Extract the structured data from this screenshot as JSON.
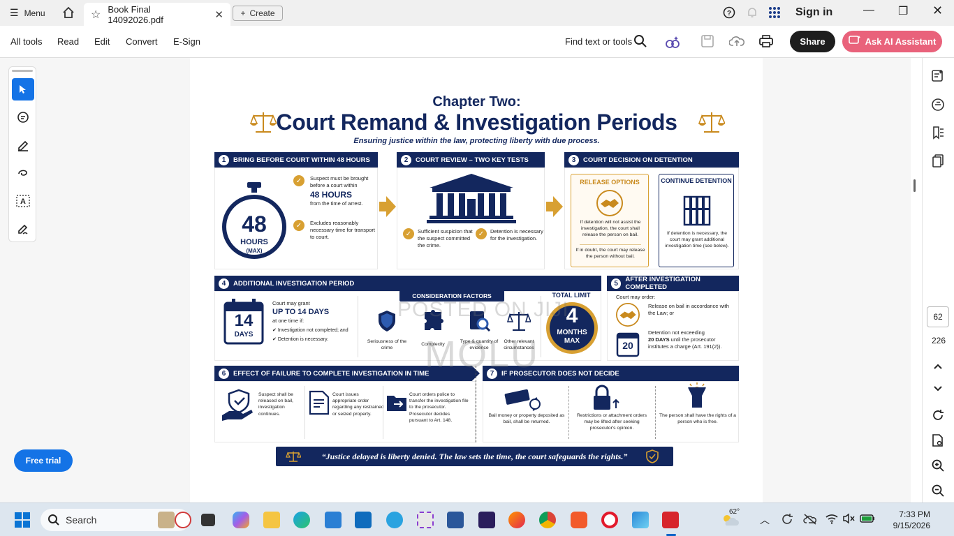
{
  "titlebar": {
    "menu_label": "Menu",
    "tab_title": "Book Final 14092026.pdf",
    "create_label": "Create",
    "signin_label": "Sign in"
  },
  "toolbar": {
    "items": [
      "All tools",
      "Read",
      "Edit",
      "Convert",
      "E-Sign"
    ],
    "find_label": "Find text or tools",
    "share_label": "Share",
    "ai_label": "Ask AI Assistant"
  },
  "left": {
    "free_trial": "Free trial"
  },
  "right": {
    "page_number": "62",
    "page_total": "226"
  },
  "doc": {
    "chapter": "Chapter Two:",
    "title": "Court Remand & Investigation Periods",
    "subtitle": "Ensuring justice within the law, protecting liberty with due process.",
    "s1": {
      "num": "1",
      "header": "Bring before court within 48 hours",
      "clock_number": "48",
      "clock_hours": "HOURS",
      "clock_max": "(MAX)",
      "line1a": "Suspect must be brought before a court within",
      "line1b": "48 HOURS",
      "line1c": "from the time of arrest.",
      "line2": "Excludes reasonably necessary time for transport to court."
    },
    "s2": {
      "num": "2",
      "header": "Court review – two key tests",
      "test1": "Sufficient suspicion that the suspect committed the crime.",
      "test2": "Detention is necessary for the investigation."
    },
    "s3": {
      "num": "3",
      "header": "Court decision on detention",
      "release_title": "RELEASE OPTIONS",
      "release_text1": "If detention will not assist the investigation, the court shall release the person on bail.",
      "release_text2": "If in doubt, the court may release the person without bail.",
      "continue_title": "CONTINUE DETENTION",
      "continue_text": "If detention is necessary, the court may grant additional investigation time (see below)."
    },
    "s4": {
      "num": "4",
      "header": "Additional investigation period",
      "days_number": "14",
      "days_label": "DAYS",
      "grant_a": "Court may grant",
      "grant_b": "UP TO 14 DAYS",
      "grant_c": "at one time if:",
      "bullet1": "Investigation not completed; and",
      "bullet2": "Detention is necessary.",
      "factors_title": "CONSIDERATION FACTORS",
      "factors": [
        "Seriousness of the crime",
        "Complexity",
        "Type & quantity of evidence",
        "Other relevant circumstances"
      ],
      "total_title": "TOTAL LIMIT",
      "total_number": "4",
      "total_months": "MONTHS",
      "total_max": "MAX"
    },
    "s5": {
      "num": "5",
      "header": "After investigation completed",
      "intro": "Court may order:",
      "opt1": "Release on bail in accordance with the Law; or",
      "cal_number": "20",
      "opt2a": "Detention not exceeding",
      "opt2b": "20 DAYS",
      "opt2c": "until the prosecutor institutes a charge (Art. 191(2))."
    },
    "s6": {
      "num": "6",
      "header": "Effect of failure to complete investigation in time",
      "items": [
        "Suspect shall be released on bail, investigation continues.",
        "Court issues appropriate order regarding any restrained or seized property.",
        "Court orders police to transfer the investigation file to the prosecutor. Prosecutor decides pursuant to Art. 148."
      ]
    },
    "s7": {
      "num": "7",
      "header": "If prosecutor does not decide",
      "items": [
        "Bail money or property deposited as bail, shall be returned.",
        "Restrictions or attachment orders may be lifted after seeking prosecutor's opinion.",
        "The person shall have the rights of a person who is free."
      ]
    },
    "quote": "“Justice delayed is liberty denied. The law sets the time, the court safeguards the rights.”",
    "watermark1": "POSTED ON JIJI",
    "watermark2": "MOLU"
  },
  "taskbar": {
    "search_label": "Search",
    "temperature": "62°",
    "time": "7:33 PM",
    "date": "9/15/2026"
  }
}
